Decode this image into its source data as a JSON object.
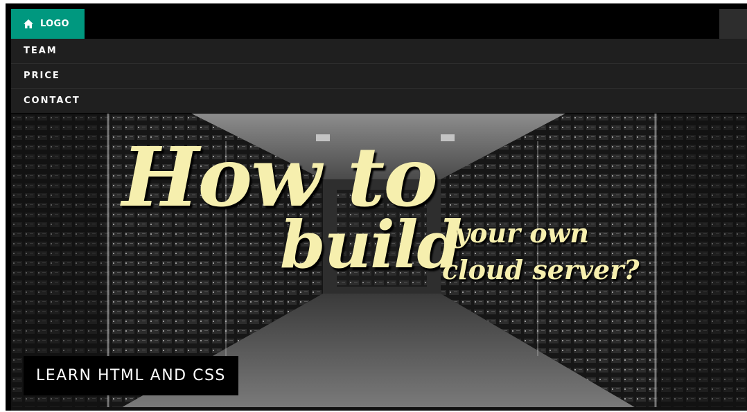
{
  "navbar": {
    "logo_label": "LOGO",
    "logo_icon": "home-icon",
    "accent_color": "#00987f"
  },
  "menu": {
    "items": [
      {
        "label": "TEAM"
      },
      {
        "label": "PRICE"
      },
      {
        "label": "CONTACT"
      }
    ]
  },
  "hero": {
    "image_text": {
      "line1": "How to",
      "line2": "build",
      "line3a": "your own",
      "line3b": "cloud server?"
    },
    "caption": "LEARN HTML AND CSS",
    "text_color": "#f6efae"
  }
}
